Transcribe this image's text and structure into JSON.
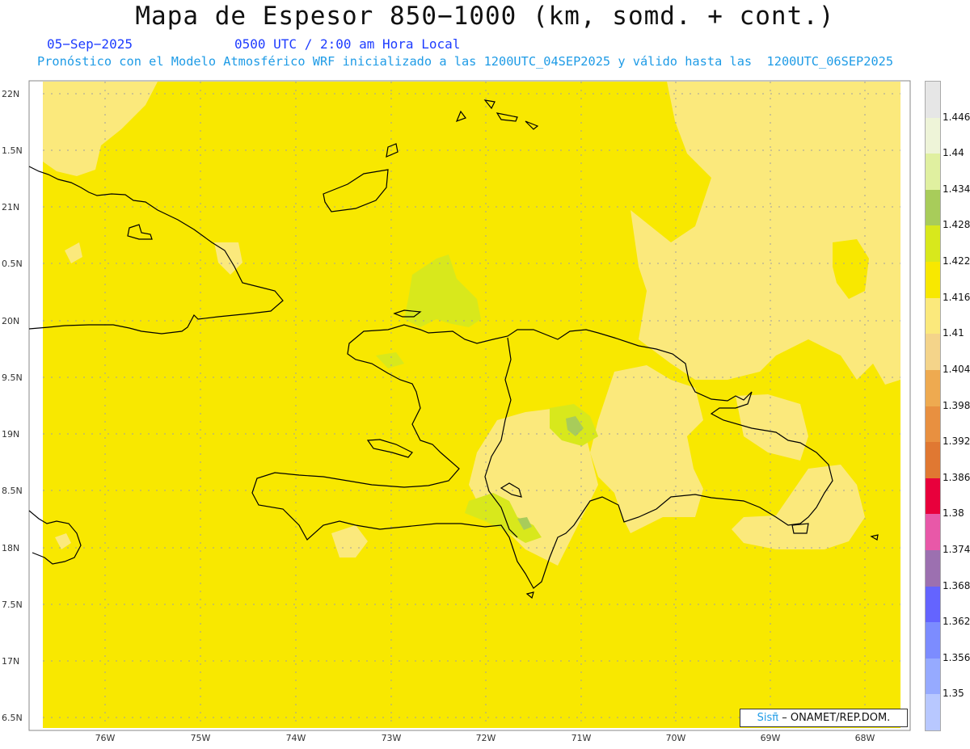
{
  "title": "Mapa de Espesor 850−1000 (km, somd. + cont.)",
  "date": "05−Sep−2025",
  "time": "0500 UTC / 2:00 am Hora Local",
  "model_info": "Pronóstico con el Modelo Atmosférico WRF inicializado a las 1200UTC_04SEP2025 y válido hasta las  1200UTC_06SEP2025",
  "credit": {
    "logo": "Sisπ̄",
    "text": "– ONAMET/REP.DOM."
  },
  "lat_labels": [
    "22N",
    "1.5N",
    "21N",
    "0.5N",
    "20N",
    "9.5N",
    "19N",
    "8.5N",
    "18N",
    "7.5N",
    "17N",
    "6.5N"
  ],
  "lon_labels": [
    "76W",
    "75W",
    "74W",
    "73W",
    "72W",
    "71W",
    "70W",
    "69W",
    "68W"
  ],
  "colorbar": {
    "labels": [
      "1.446",
      "1.44",
      "1.434",
      "1.428",
      "1.422",
      "1.416",
      "1.41",
      "1.404",
      "1.398",
      "1.392",
      "1.386",
      "1.38",
      "1.374",
      "1.368",
      "1.362",
      "1.356",
      "1.35"
    ],
    "colors": [
      "#e6e6e6",
      "#eef4d8",
      "#e0f0a0",
      "#a8cc5a",
      "#d8e81c",
      "#f8e800",
      "#fbe97c",
      "#f4d48a",
      "#eeaa50",
      "#e89040",
      "#e07832",
      "#e8003c",
      "#e858a8",
      "#9c70b0",
      "#6464ff",
      "#7c8cff",
      "#96aaff",
      "#b8c8ff"
    ]
  },
  "colors": {
    "base_field": "#f8e800",
    "light_field": "#fbe97c",
    "green_field": "#d8e81c",
    "dark_green": "#a8cc5a",
    "coast": "#000000"
  }
}
